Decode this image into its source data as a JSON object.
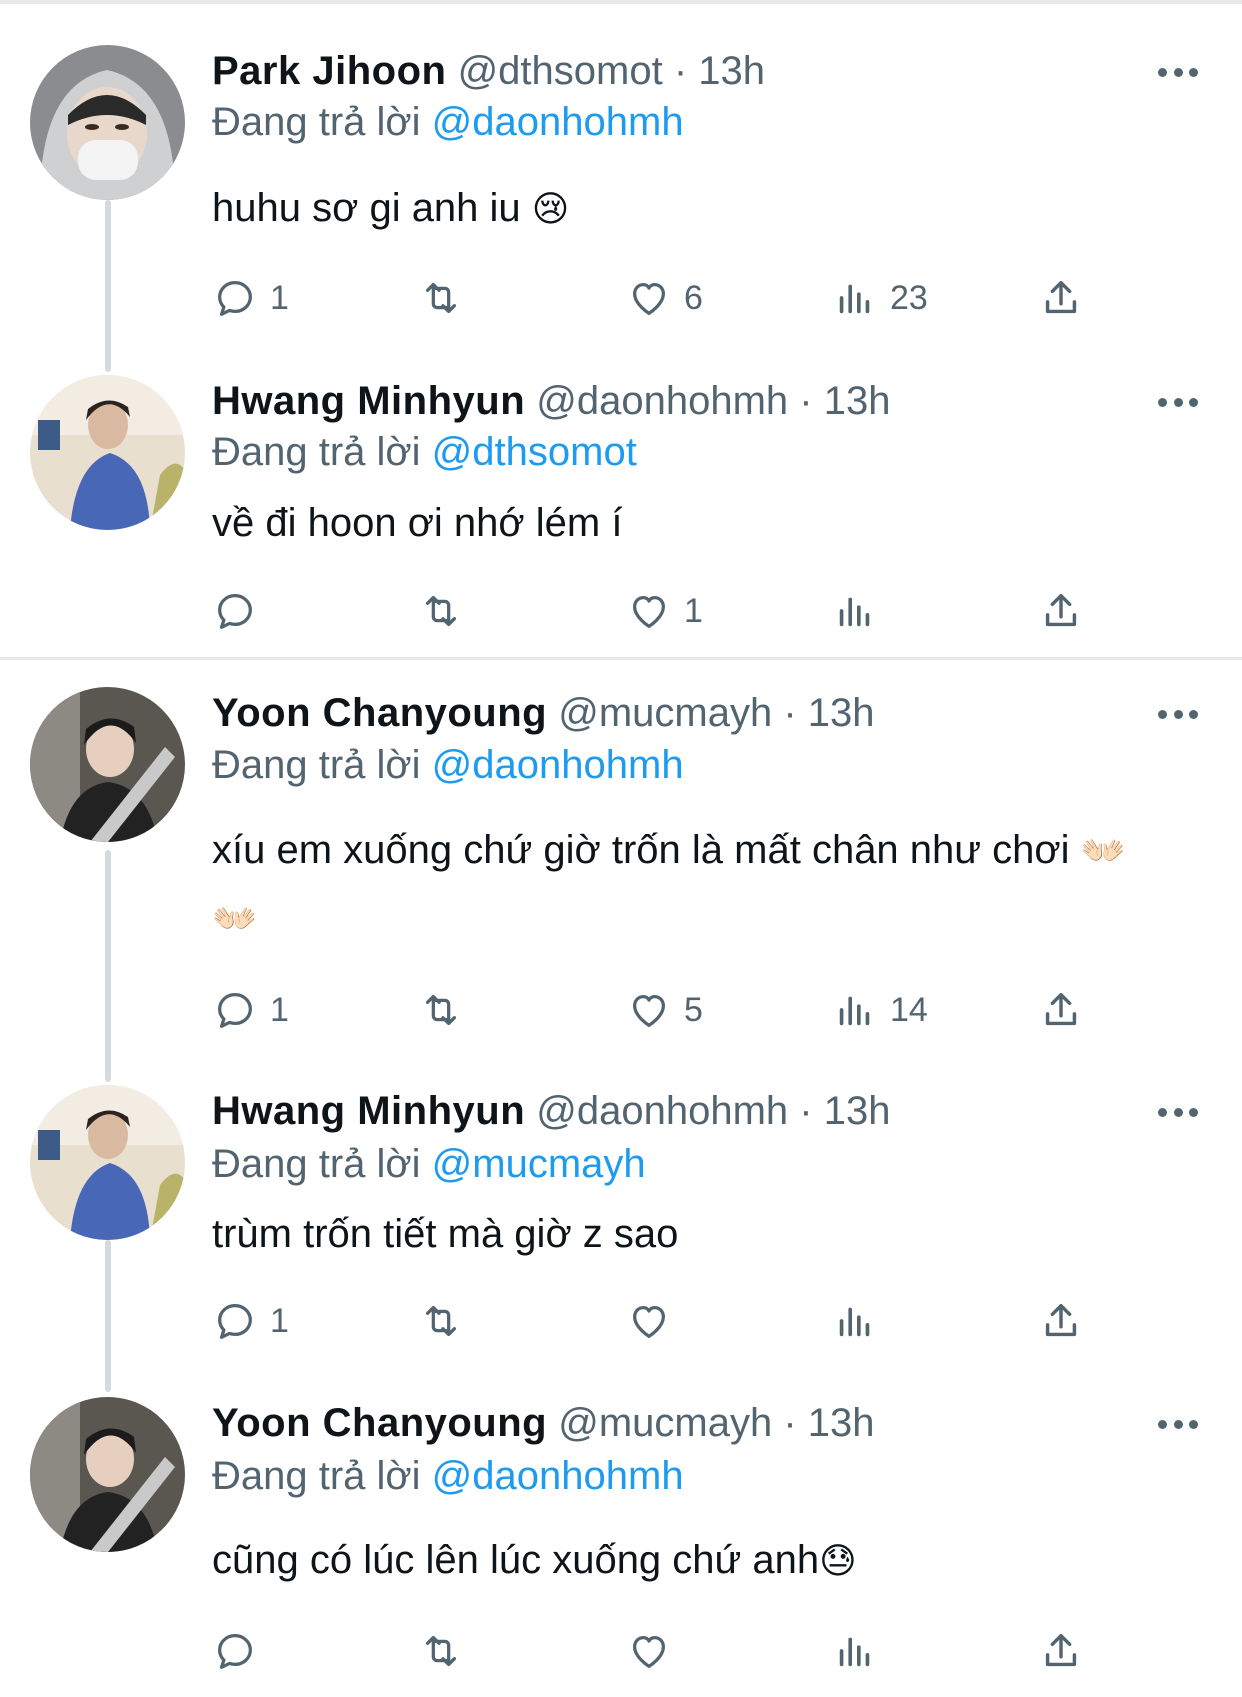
{
  "tweets": [
    {
      "name": "Park Jihoon",
      "handle": "@dthsomot",
      "dot": "·",
      "time": "13h",
      "reply_prefix": "Đang trả lời",
      "reply_to": "@daonhohmh",
      "text": "huhu sơ gi anh iu",
      "emoji": "😢",
      "reply_count": "1",
      "retweet_count": "",
      "like_count": "6",
      "view_count": "23"
    },
    {
      "name": "Hwang Minhyun",
      "handle": "@daonhohmh",
      "dot": "·",
      "time": "13h",
      "reply_prefix": "Đang trả lời",
      "reply_to": "@dthsomot",
      "text": "về đi hoon ơi nhớ lém í",
      "emoji": "",
      "reply_count": "",
      "retweet_count": "",
      "like_count": "1",
      "view_count": ""
    },
    {
      "name": "Yoon Chanyoung",
      "handle": "@mucmayh",
      "dot": "·",
      "time": "13h",
      "reply_prefix": "Đang trả lời",
      "reply_to": "@daonhohmh",
      "text": "xíu em xuống chứ giờ trốn là mất chân như chơi",
      "emoji": "👐🏻",
      "emoji_line2": "👐🏻",
      "reply_count": "1",
      "retweet_count": "",
      "like_count": "5",
      "view_count": "14"
    },
    {
      "name": "Hwang Minhyun",
      "handle": "@daonhohmh",
      "dot": "·",
      "time": "13h",
      "reply_prefix": "Đang trả lời",
      "reply_to": "@mucmayh",
      "text": "trùm trốn tiết mà giờ z sao",
      "emoji": "",
      "reply_count": "1",
      "retweet_count": "",
      "like_count": "",
      "view_count": ""
    },
    {
      "name": "Yoon Chanyoung",
      "handle": "@mucmayh",
      "dot": "·",
      "time": "13h",
      "reply_prefix": "Đang trả lời",
      "reply_to": "@daonhohmh",
      "text": "cũng có lúc lên lúc xuống chứ anh",
      "emoji": "😓",
      "reply_count": "",
      "retweet_count": "",
      "like_count": "",
      "view_count": ""
    }
  ],
  "icons": {
    "more": "more-icon",
    "reply": "reply-icon",
    "retweet": "retweet-icon",
    "like": "heart-icon",
    "views": "views-icon",
    "share": "share-icon"
  },
  "colors": {
    "link": "#1d9bf0",
    "muted": "#536471",
    "text": "#0f1419",
    "divider": "#e6e9ec"
  }
}
